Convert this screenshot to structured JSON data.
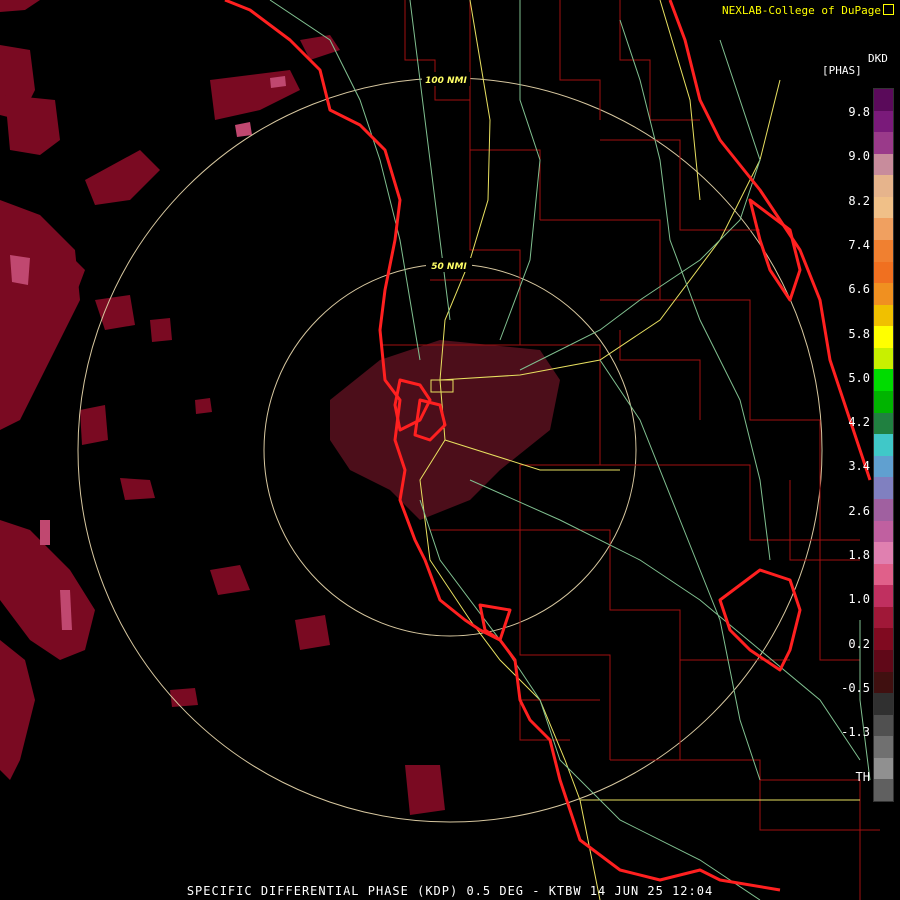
{
  "credit": "NEXLAB-College of DuPage",
  "legend": {
    "title": "DKD",
    "units": "[PHAS]",
    "ticks": [
      "9.8",
      "9.0",
      "8.2",
      "7.4",
      "6.6",
      "5.8",
      "5.0",
      "4.2",
      "3.4",
      "2.6",
      "1.8",
      "1.0",
      "0.2",
      "-0.5",
      "-1.3",
      "TH"
    ],
    "colors": [
      "#5a0a5a",
      "#7a1a7a",
      "#9a3a8a",
      "#c88c9c",
      "#e6b48c",
      "#f0c088",
      "#f0a060",
      "#f08030",
      "#f07020",
      "#f09020",
      "#f0c000",
      "#ffff00",
      "#c8f000",
      "#00dc00",
      "#00b400",
      "#208040",
      "#40c8c8",
      "#60a0d0",
      "#8080c0",
      "#a060a0",
      "#c060a0",
      "#e080b0",
      "#e0608a",
      "#c03060",
      "#a01838",
      "#800a20",
      "#600818",
      "#401010",
      "#303030",
      "#505050",
      "#707070",
      "#909090",
      "#606060"
    ]
  },
  "rings": [
    {
      "label": "100 NMI"
    },
    {
      "label": "50 NMI"
    }
  ],
  "footer": "SPECIFIC DIFFERENTIAL PHASE (KDP) 0.5 DEG - KTBW 14 JUN 25 12:04"
}
